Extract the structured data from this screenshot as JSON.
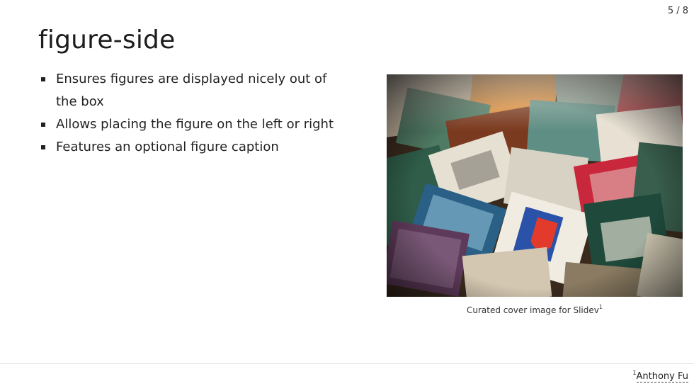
{
  "slide": {
    "page_indicator": "5 / 8",
    "title": "figure-side",
    "bullets": [
      "Ensures figures are displayed nicely out of the box",
      "Allows placing the figure on the left or right",
      "Features an optional figure caption"
    ],
    "figure": {
      "caption": "Curated cover image for Slidev",
      "caption_footnote_ref": "1",
      "image": "postage-stamps-photo"
    },
    "footnote": {
      "number": "1",
      "text": "Anthony Fu"
    }
  },
  "colors": {
    "background": "#ffffff",
    "text": "#1f1f1f",
    "rule": "#e2e2e2"
  }
}
